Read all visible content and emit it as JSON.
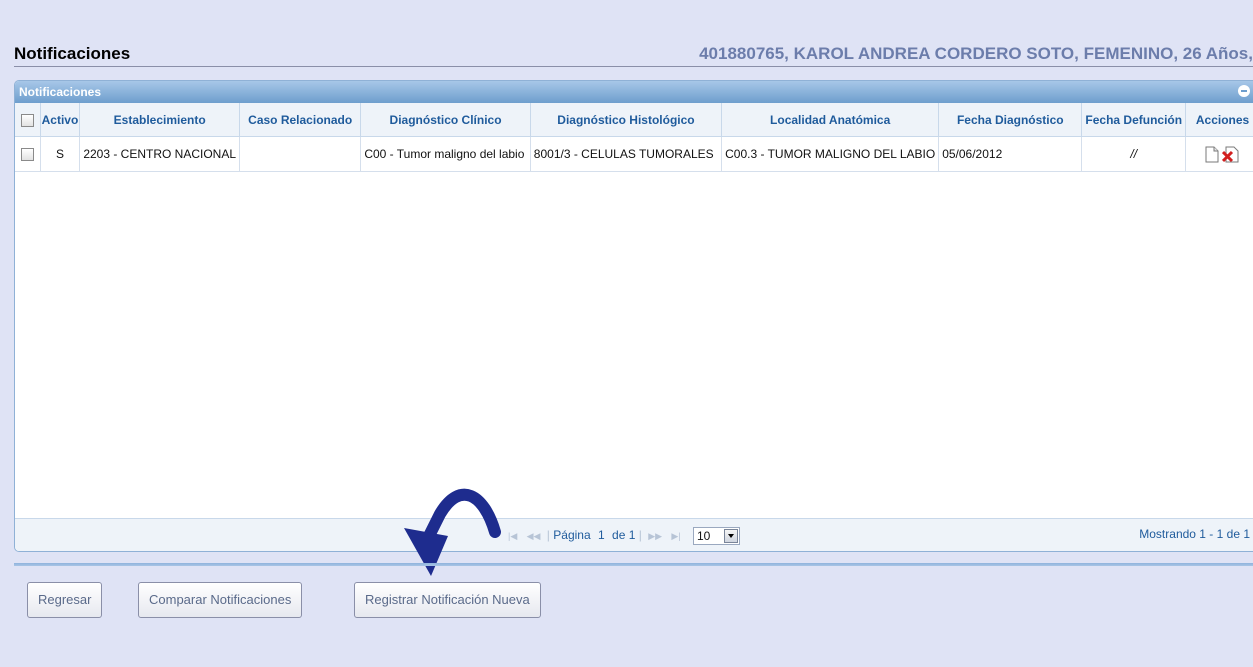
{
  "header": {
    "title": "Notificaciones",
    "patient": "401880765, KAROL ANDREA CORDERO SOTO, FEMENINO, 26 Años,"
  },
  "grid": {
    "caption": "Notificaciones",
    "columns": [
      "",
      "Activo",
      "Establecimiento",
      "Caso Relacionado",
      "Diagnóstico Clínico",
      "Diagnóstico Histológico",
      "Localidad Anatómica",
      "Fecha Diagnóstico",
      "Fecha Defunción",
      "Acciones"
    ],
    "rows": [
      {
        "activo": "S",
        "establecimiento": "2203 - CENTRO NACIONAL",
        "caso_relacionado": "",
        "diagnostico_clinico": "C00 - Tumor maligno del labio",
        "diagnostico_histologico": "8001/3 - CELULAS TUMORALES",
        "localidad": "C00.3 - TUMOR MALIGNO DEL LABIO",
        "fecha_diagnostico": "05/06/2012",
        "fecha_defuncion": "//"
      }
    ],
    "actions": [
      "view-icon",
      "delete-icon"
    ]
  },
  "pager": {
    "page_label": "Página",
    "page": "1",
    "of_label": "de 1",
    "rows_per_page": "10",
    "info": "Mostrando 1 - 1 de 1"
  },
  "buttons": {
    "back": "Regresar",
    "compare": "Comparar Notificaciones",
    "register": "Registrar Notificación Nueva"
  }
}
